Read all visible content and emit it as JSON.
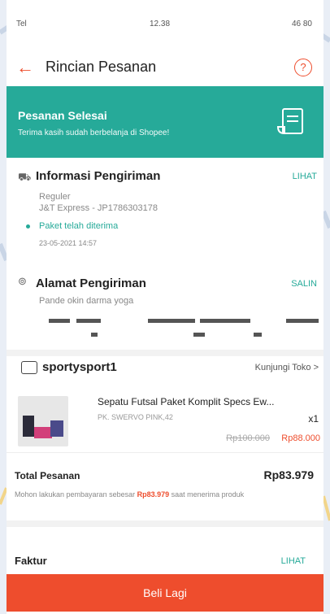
{
  "status_bar": {
    "signal": "Tel",
    "time": "12.38",
    "battery": "46 80"
  },
  "header": {
    "title": "Rincian Pesanan",
    "help": "?"
  },
  "banner": {
    "title": "Pesanan Selesai",
    "subtitle": "Terima kasih sudah berbelanja di Shopee!"
  },
  "shipping_info": {
    "title": "Informasi Pengiriman",
    "link": "LIHAT",
    "service": "Reguler",
    "courier": "J&T Express - JP1786303178",
    "status": "Paket telah diterima",
    "timestamp": "23-05-2021 14:57"
  },
  "address": {
    "title": "Alamat Pengiriman",
    "link": "SALIN",
    "name": "Pande okin darma yoga"
  },
  "shop": {
    "name": "sportysport1",
    "visit": "Kunjungi Toko >"
  },
  "product": {
    "name": "Sepatu Futsal Paket Komplit Specs Ew...",
    "variant": "PK. SWERVO PINK,42",
    "qty": "x1",
    "original_price": "Rp100.000",
    "price": "Rp88.000"
  },
  "total": {
    "label": "Total Pesanan",
    "value": "Rp83.979",
    "note_prefix": "Mohon lakukan pembayaran sebesar ",
    "note_amount": "Rp83.979",
    "note_suffix": " saat menerima produk"
  },
  "invoice": {
    "label": "Faktur",
    "link": "LIHAT"
  },
  "action": {
    "buy_again": "Beli Lagi"
  },
  "colors": {
    "brand": "#ee4d2d",
    "accent": "#26aa99"
  }
}
